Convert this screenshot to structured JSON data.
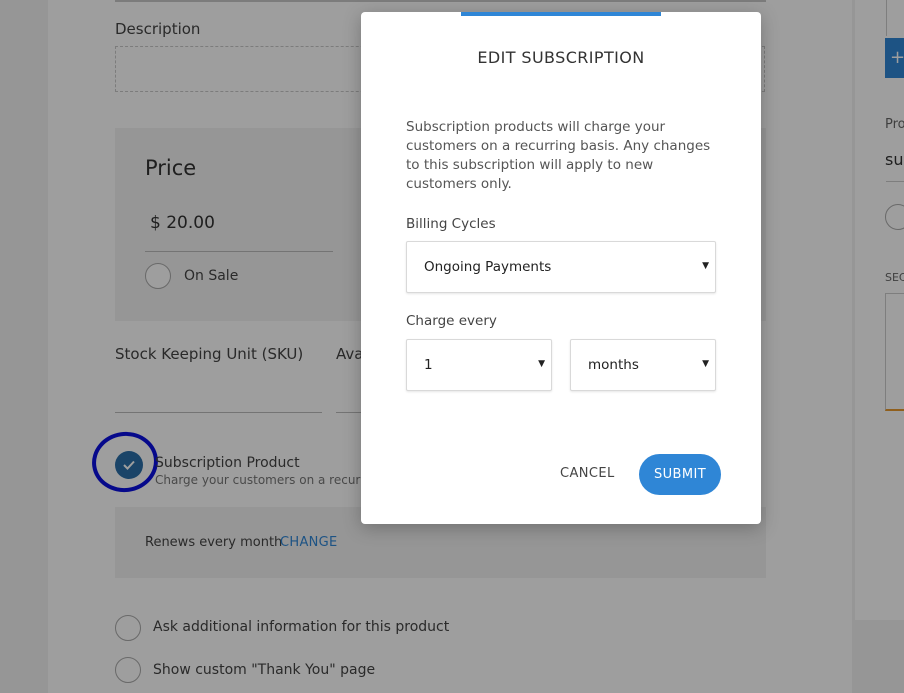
{
  "background_form": {
    "description_label": "Description",
    "price": {
      "title": "Price",
      "value": "$ 20.00",
      "on_sale_label": "On Sale"
    },
    "sku_label": "Stock Keeping Unit (SKU)",
    "availability_label_partial": "Ava",
    "subscription": {
      "title": "Subscription Product",
      "description": "Charge your customers on a recurring",
      "checked": true,
      "renews_text": "Renews every month",
      "change_link": "CHANGE"
    },
    "options": [
      {
        "label": "Ask additional information for this product"
      },
      {
        "label": "Show custom \"Thank You\" page"
      }
    ]
  },
  "right_panel": {
    "button_label": "+",
    "field_label_partial": "Pro",
    "field_value_partial": "sul",
    "section_label_partial": "SEC"
  },
  "modal": {
    "title": "EDIT SUBSCRIPTION",
    "description": "Subscription products will charge your customers on a recurring basis. Any changes to this subscription will apply to new customers only.",
    "billing_cycles": {
      "label": "Billing Cycles",
      "value": "Ongoing Payments"
    },
    "charge_every": {
      "label": "Charge every",
      "count": "1",
      "unit": "months"
    },
    "cancel_label": "CANCEL",
    "submit_label": "SUBMIT"
  },
  "colors": {
    "accent": "#2f86d6",
    "annotation": "#0a10e0",
    "checkbox": "#2b6fa8"
  }
}
